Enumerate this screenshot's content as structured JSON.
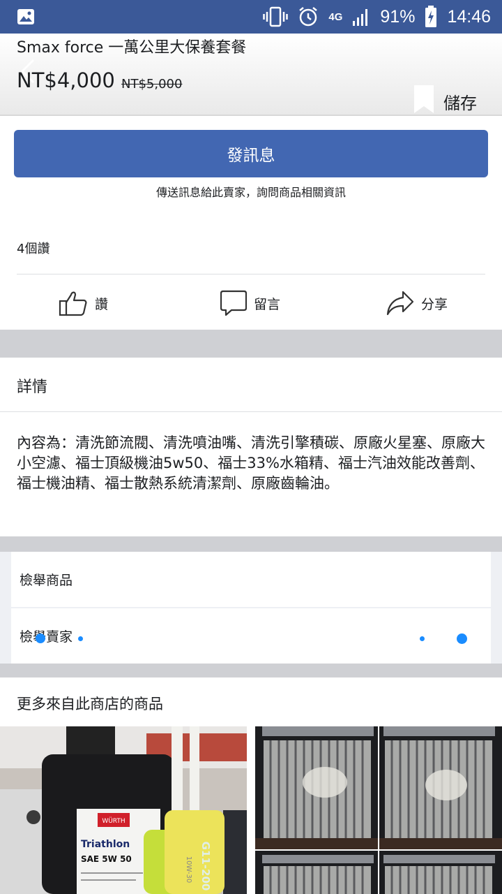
{
  "status_bar": {
    "battery": "91%",
    "network": "4G",
    "time": "14:46",
    "icons": [
      "image-icon",
      "vibrate-icon",
      "alarm-icon",
      "network-4g-icon",
      "signal-icon",
      "battery-charging-icon"
    ]
  },
  "header": {
    "title": "Smax force  一萬公里大保養套餐",
    "price": "NT$4,000",
    "old_price": "NT$5,000",
    "save_label": "儲存"
  },
  "message": {
    "button_label": "發訊息",
    "subtitle": "傳送訊息給此賣家，詢問商品相關資訊"
  },
  "likes_count": "4個讚",
  "actions": {
    "like": "讚",
    "comment": "留言",
    "share": "分享"
  },
  "details": {
    "title": "詳情",
    "body": "內容為：清洗節流閥、清洗噴油嘴、清洗引擎積碳、原廠火星塞、原廠大小空濾、福士頂級機油5w50、福士33%水箱精、福士汽油效能改善劑、福士機油精、福士散熱系統清潔劑、原廠齒輪油。"
  },
  "report": {
    "product": "檢舉商品",
    "seller": "檢舉賣家"
  },
  "more_from_shop": {
    "title": "更多來自此商店的商品"
  },
  "product_images": {
    "oil_brand": "WÜRTH",
    "oil_name": "Triathlon",
    "oil_grade": "SAE 5W 50",
    "tube_label": "G11-200",
    "tube_grade": "10W-30"
  },
  "colors": {
    "status_bar": "#3b5998",
    "button": "#4267b2",
    "dot": "#1a8cff"
  }
}
